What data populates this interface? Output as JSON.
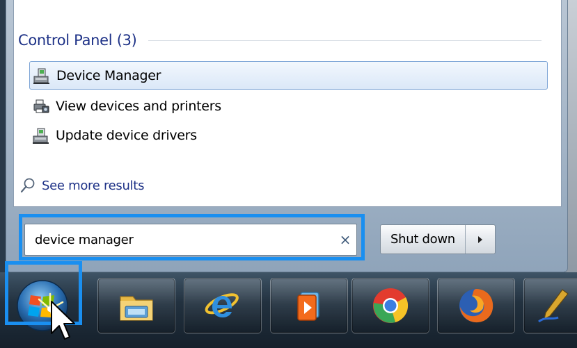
{
  "start_menu": {
    "section_title": "Control Panel (3)",
    "results": [
      {
        "label": "Device Manager",
        "icon": "device-manager-icon",
        "selected": true
      },
      {
        "label": "View devices and printers",
        "icon": "printer-icon",
        "selected": false
      },
      {
        "label": "Update device drivers",
        "icon": "device-manager-icon",
        "selected": false
      }
    ],
    "see_more_label": "See more results",
    "search": {
      "value": "device manager",
      "clear_glyph": "×"
    },
    "shutdown_label": "Shut down"
  },
  "taskbar": {
    "icons": [
      "start-orb-icon",
      "windows-explorer-icon",
      "internet-explorer-icon",
      "windows-media-player-icon",
      "chrome-icon",
      "firefox-icon",
      "pen-app-icon"
    ]
  },
  "colors": {
    "highlight_box": "#1a8ff0",
    "link_blue": "#1e3287",
    "selection_border": "#7fa6d6"
  }
}
